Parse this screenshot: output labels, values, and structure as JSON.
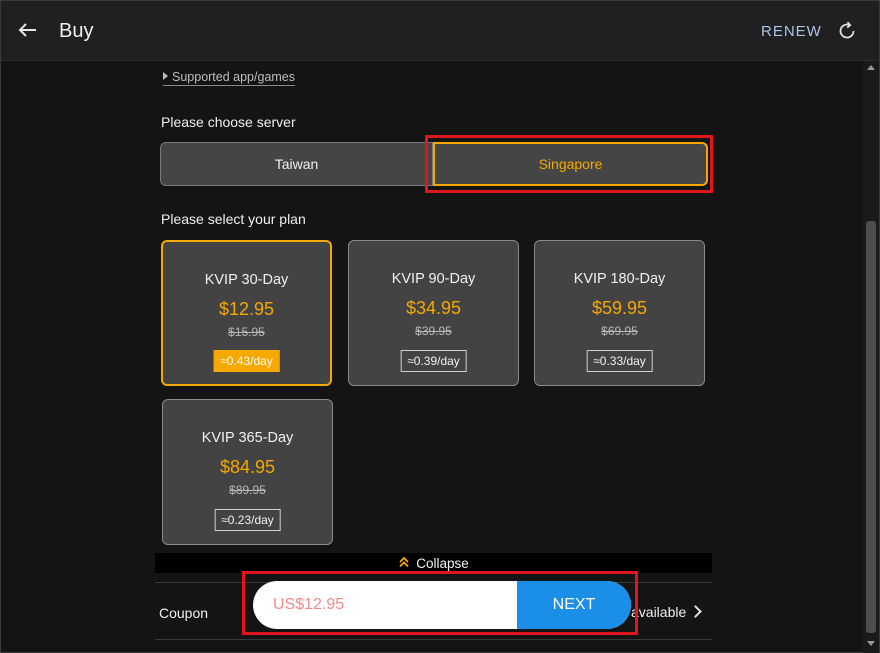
{
  "header": {
    "title": "Buy",
    "renew_label": "RENEW",
    "back_icon": "arrow-left-icon",
    "refresh_icon": "refresh-icon"
  },
  "supported_link": "Supported app/games",
  "server": {
    "label": "Please choose server",
    "options": [
      "Taiwan",
      "Singapore"
    ],
    "selected": "Singapore"
  },
  "plans": {
    "label": "Please select your plan",
    "items": [
      {
        "name": "KVIP 30-Day",
        "price": "$12.95",
        "original": "$15.95",
        "daily": "≈0.43/day",
        "selected": true
      },
      {
        "name": "KVIP 90-Day",
        "price": "$34.95",
        "original": "$39.95",
        "daily": "≈0.39/day",
        "selected": false
      },
      {
        "name": "KVIP 180-Day",
        "price": "$59.95",
        "original": "$69.95",
        "daily": "≈0.33/day",
        "selected": false
      },
      {
        "name": "KVIP 365-Day",
        "price": "$84.95",
        "original": "$89.95",
        "daily": "≈0.23/day",
        "selected": false
      }
    ]
  },
  "collapse_label": "Collapse",
  "coupon": {
    "label": "Coupon",
    "available_text": "available"
  },
  "checkout": {
    "total": "US$12.95",
    "next_label": "NEXT"
  },
  "colors": {
    "accent": "#f5a800",
    "primary_button": "#1b8fe8",
    "highlight": "#e0161e"
  }
}
